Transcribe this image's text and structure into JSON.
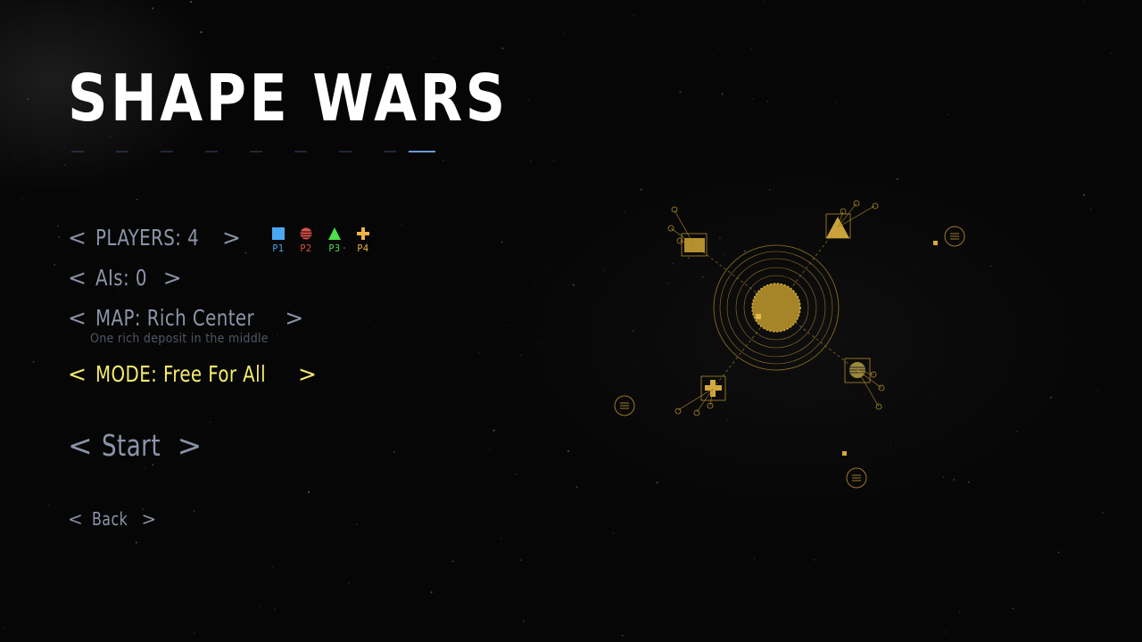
{
  "title": "SHAPE WARS",
  "menu": {
    "players_label": "PLAYERS: 4",
    "ais_label": "AIs: 0",
    "map_label": "MAP: Rich Center",
    "map_description": "One rich deposit in the middle",
    "mode_label": "MODE: Free For All",
    "start_label": "Start",
    "back_label": "Back",
    "left_arrow": "<",
    "right_arrow": ">"
  },
  "players": [
    {
      "label": "P1",
      "shape": "square",
      "color": "#4aa8f0"
    },
    {
      "label": "P2",
      "shape": "circle",
      "color": "#e0504a"
    },
    {
      "label": "P3",
      "shape": "triangle",
      "color": "#4ee04a"
    },
    {
      "label": "P4",
      "shape": "cross",
      "color": "#f0b24a"
    }
  ],
  "colors": {
    "highlight": "#f5ec6e",
    "menu_text": "#8c95a8",
    "map_preview": "#c9a23a"
  }
}
